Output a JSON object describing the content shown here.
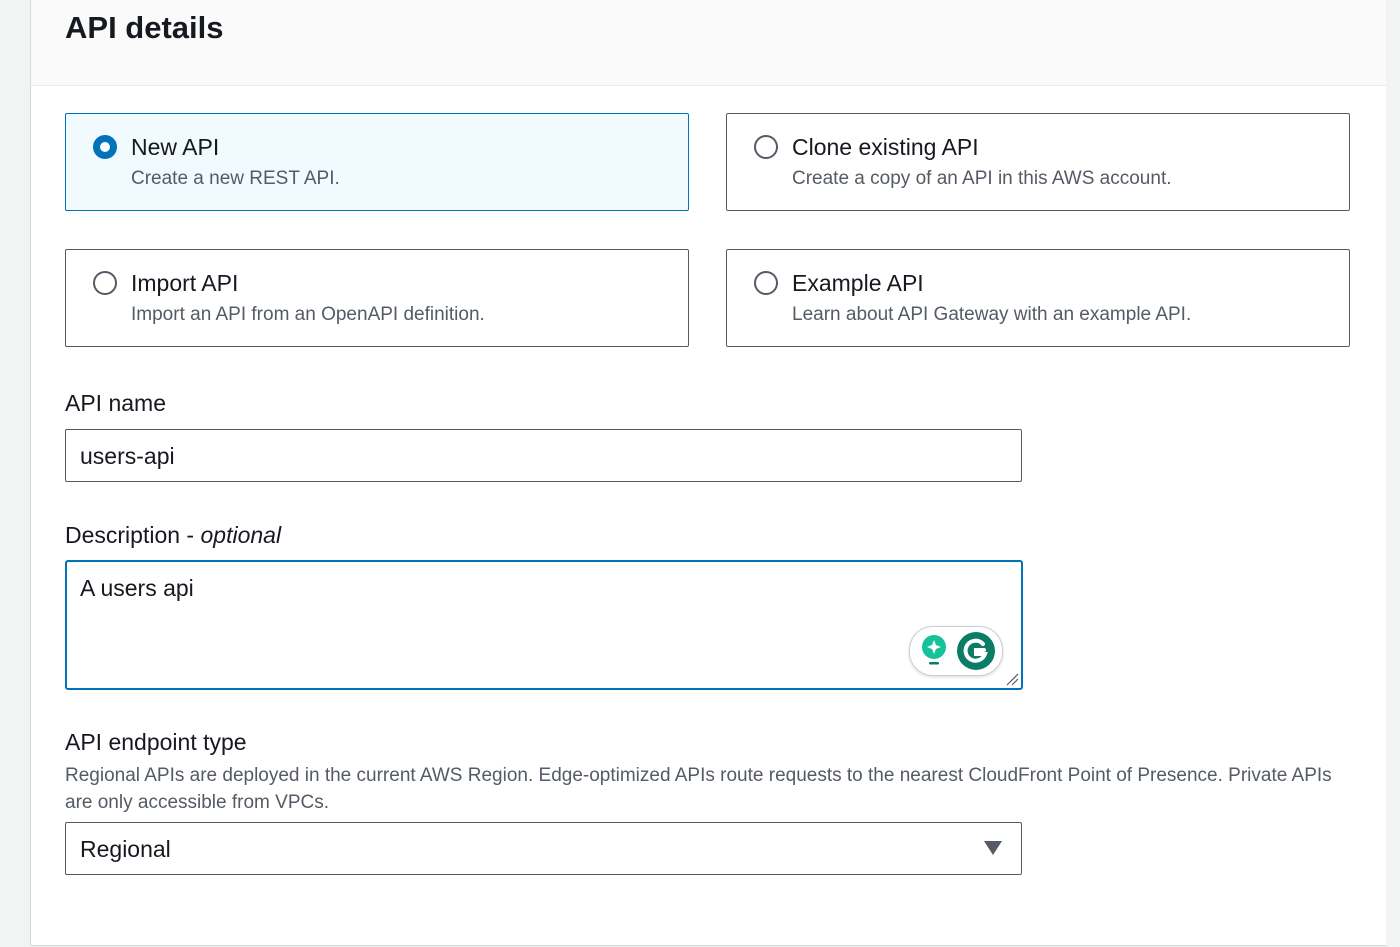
{
  "section": {
    "title": "API details"
  },
  "api_type_options": [
    {
      "title": "New API",
      "description": "Create a new REST API.",
      "selected": true
    },
    {
      "title": "Clone existing API",
      "description": "Create a copy of an API in this AWS account.",
      "selected": false
    },
    {
      "title": "Import API",
      "description": "Import an API from an OpenAPI definition.",
      "selected": false
    },
    {
      "title": "Example API",
      "description": "Learn about API Gateway with an example API.",
      "selected": false
    }
  ],
  "api_name": {
    "label": "API name",
    "value": "users-api"
  },
  "description": {
    "label": "Description -",
    "label_optional": "optional",
    "value": "A users api"
  },
  "endpoint_type": {
    "label": "API endpoint type",
    "help": "Regional APIs are deployed in the current AWS Region. Edge-optimized APIs route requests to the nearest CloudFront Point of Presence. Private APIs are only accessible from VPCs.",
    "selected": "Regional"
  },
  "icons": {
    "radio": "radio-button-icon",
    "dropdown": "caret-down-icon",
    "grammarly": "grammarly-icon",
    "suggestion": "lightbulb-icon"
  },
  "colors": {
    "accent": "#0073bb",
    "selected_tile_bg": "#f1faff",
    "grammarly_green": "#15c39a",
    "grammarly_dark": "#0b7d67"
  }
}
